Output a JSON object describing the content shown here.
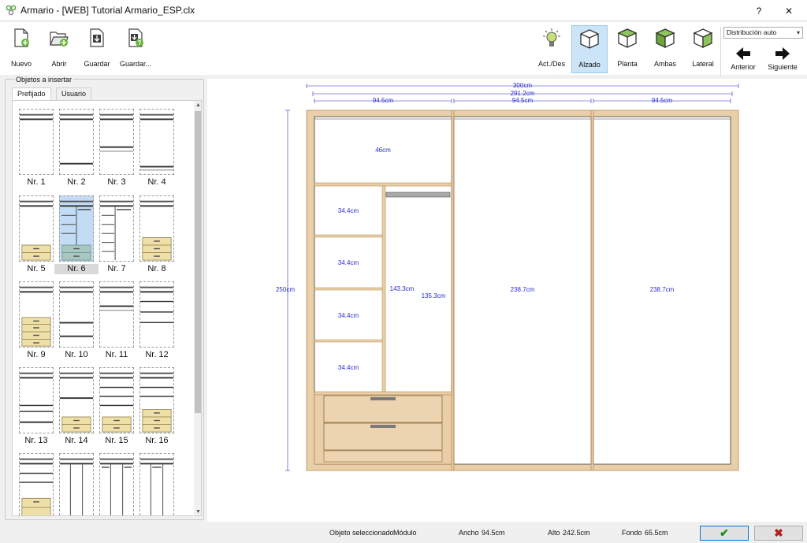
{
  "window": {
    "title": "Armario - [WEB] Tutorial Armario_ESP.clx",
    "help_glyph": "?",
    "close_glyph": "✕"
  },
  "toolbar": {
    "file_buttons": [
      {
        "label": "Nuevo",
        "icon": "new-file-icon"
      },
      {
        "label": "Abrir",
        "icon": "open-folder-icon"
      },
      {
        "label": "Guardar",
        "icon": "save-icon"
      },
      {
        "label": "Guardar...",
        "icon": "save-as-icon"
      }
    ],
    "view_buttons": [
      {
        "label": "Act./Des",
        "icon": "lightbulb-icon"
      },
      {
        "label": "Alzado",
        "icon": "cube-front-icon",
        "active": true
      },
      {
        "label": "Planta",
        "icon": "cube-top-icon"
      },
      {
        "label": "Ambas",
        "icon": "cube-both-icon"
      },
      {
        "label": "Lateral",
        "icon": "cube-side-icon"
      }
    ],
    "distribution_select": "Distribución auto",
    "nav": {
      "prev_label": "Anterior",
      "next_label": "Siguiente"
    }
  },
  "objects_panel": {
    "legend": "Objetos a insertar",
    "tabs": [
      {
        "label": "Prefijado",
        "active": true
      },
      {
        "label": "Usuario",
        "active": false
      }
    ],
    "items": [
      "Nr. 1",
      "Nr. 2",
      "Nr. 3",
      "Nr. 4",
      "Nr. 5",
      "Nr. 6",
      "Nr. 7",
      "Nr. 8",
      "Nr. 9",
      "Nr. 10",
      "Nr. 11",
      "Nr. 12",
      "Nr. 13",
      "Nr. 14",
      "Nr. 15",
      "Nr. 16"
    ],
    "selected_item": "Nr. 6"
  },
  "drawing": {
    "dims_top": {
      "total": "300cm",
      "inner": "291.2cm",
      "module": "94.5cm"
    },
    "height": "250cm",
    "col1_top_shelf": "46cm",
    "shelf_height": "34.4cm",
    "shelf_count": 4,
    "hanging_height_1": "143.3cm",
    "hanging_height_2": "135.3cm",
    "door_height": "238.7cm",
    "colors": {
      "wood": "#e8cfa8",
      "wood_edge": "#b98d55",
      "dim": "#2a2ad0",
      "line": "#3b3b3b"
    }
  },
  "status": {
    "selected_label": "Objeto seleccionado",
    "selected_value": "Módulo",
    "width_label": "Ancho",
    "width_value": "94.5cm",
    "height_label": "Alto",
    "height_value": "242.5cm",
    "depth_label": "Fondo",
    "depth_value": "65.5cm",
    "ok_glyph": "✔",
    "cancel_glyph": "✖"
  }
}
